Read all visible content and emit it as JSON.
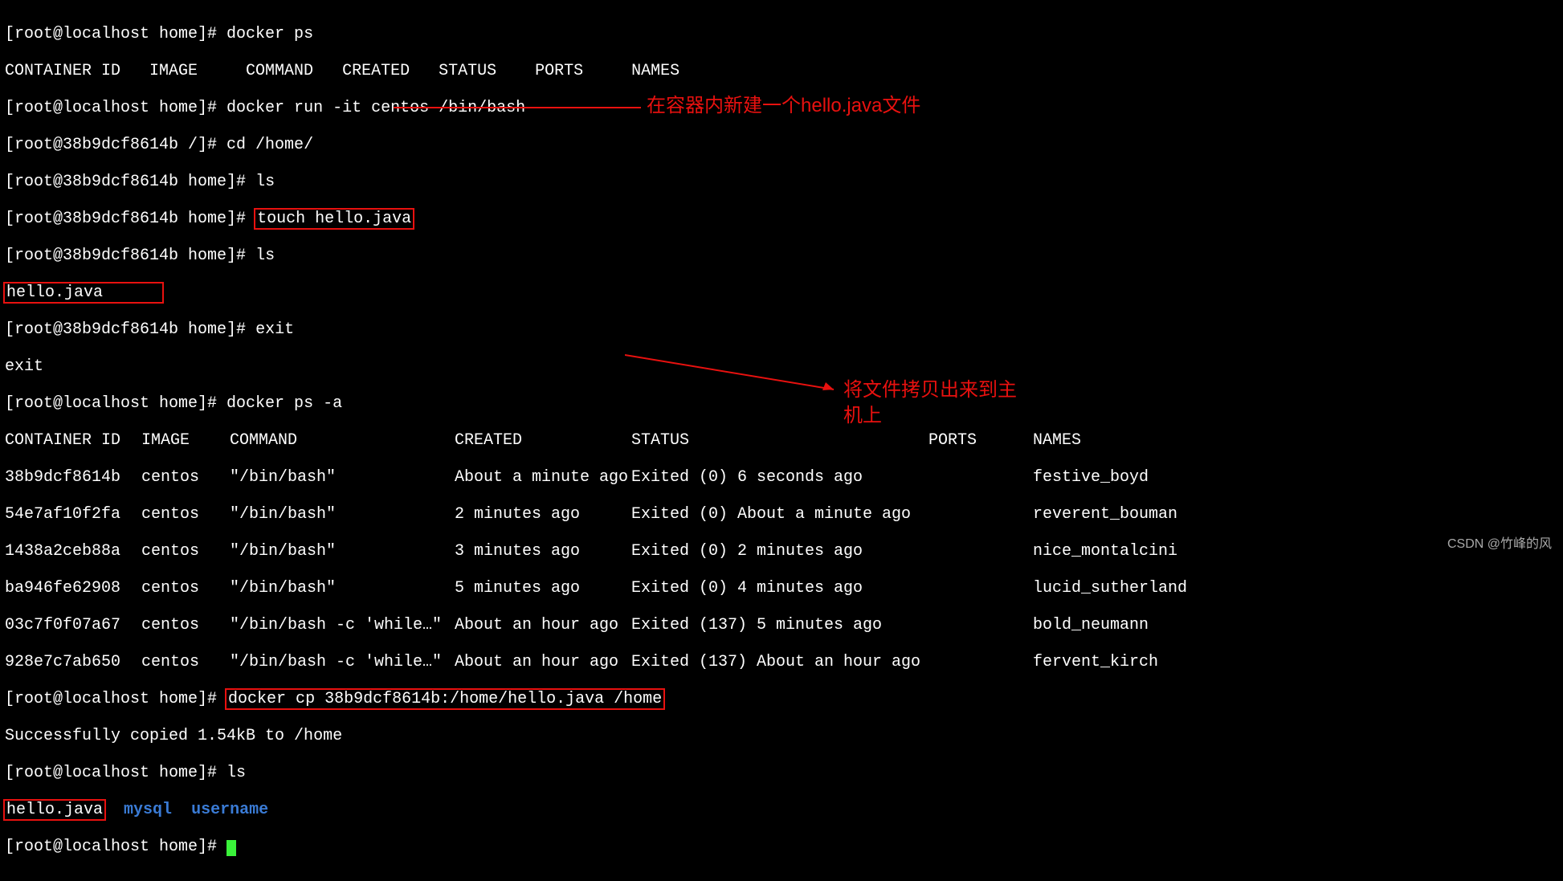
{
  "prompts": {
    "local_home": "[root@localhost home]# ",
    "container_root": "[root@38b9dcf8614b /]# ",
    "container_home": "[root@38b9dcf8614b home]# "
  },
  "commands": {
    "docker_ps": "docker ps",
    "docker_ps_header": "CONTAINER ID   IMAGE     COMMAND   CREATED   STATUS    PORTS     NAMES",
    "docker_run": "docker run -it centos /bin/bash",
    "cd_home": "cd /home/",
    "ls": "ls",
    "touch": "touch hello.java",
    "hello_file": "hello.java",
    "exit": "exit",
    "exit_echo": "exit",
    "docker_ps_a": "docker ps -a",
    "docker_cp": "docker cp 38b9dcf8614b:/home/hello.java /home",
    "copied_msg": "Successfully copied 1.54kB to /home",
    "final_ls": {
      "file": "hello.java",
      "dir1": "mysql",
      "dir2": "username"
    }
  },
  "ps_table": {
    "headers": {
      "container_id": "CONTAINER ID",
      "image": "IMAGE",
      "command": "COMMAND",
      "created": "CREATED",
      "status": "STATUS",
      "ports": "PORTS",
      "names": "NAMES"
    },
    "rows": [
      {
        "id": "38b9dcf8614b",
        "image": "centos",
        "cmd": "\"/bin/bash\"",
        "created": "About a minute ago",
        "status": "Exited (0) 6 seconds ago",
        "ports": "",
        "names": "festive_boyd"
      },
      {
        "id": "54e7af10f2fa",
        "image": "centos",
        "cmd": "\"/bin/bash\"",
        "created": "2 minutes ago",
        "status": "Exited (0) About a minute ago",
        "ports": "",
        "names": "reverent_bouman"
      },
      {
        "id": "1438a2ceb88a",
        "image": "centos",
        "cmd": "\"/bin/bash\"",
        "created": "3 minutes ago",
        "status": "Exited (0) 2 minutes ago",
        "ports": "",
        "names": "nice_montalcini"
      },
      {
        "id": "ba946fe62908",
        "image": "centos",
        "cmd": "\"/bin/bash\"",
        "created": "5 minutes ago",
        "status": "Exited (0) 4 minutes ago",
        "ports": "",
        "names": "lucid_sutherland"
      },
      {
        "id": "03c7f0f07a67",
        "image": "centos",
        "cmd": "\"/bin/bash -c 'while…\"",
        "created": "About an hour ago",
        "status": "Exited (137) 5 minutes ago",
        "ports": "",
        "names": "bold_neumann"
      },
      {
        "id": "928e7c7ab650",
        "image": "centos",
        "cmd": "\"/bin/bash -c 'while…\"",
        "created": "About an hour ago",
        "status": "Exited (137) About an hour ago",
        "ports": "",
        "names": "fervent_kirch"
      }
    ]
  },
  "annotations": {
    "touch": "在容器内新建一个hello.java文件",
    "cp_line1": "将文件拷贝出来到主",
    "cp_line2": "机上"
  },
  "watermark": "CSDN @竹峰的风"
}
